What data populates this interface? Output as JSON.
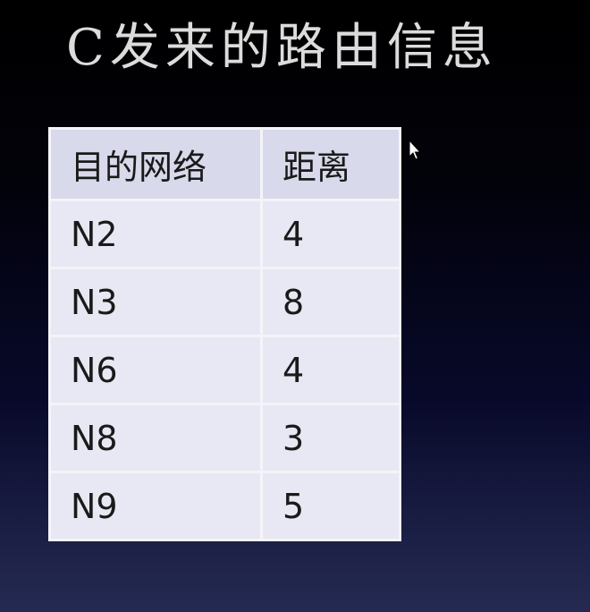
{
  "title": "C发来的路由信息",
  "table": {
    "headers": [
      "目的网络",
      "距离"
    ],
    "rows": [
      {
        "network": "N2",
        "distance": "4"
      },
      {
        "network": "N3",
        "distance": "8"
      },
      {
        "network": "N6",
        "distance": "4"
      },
      {
        "network": "N8",
        "distance": "3"
      },
      {
        "network": "N9",
        "distance": "5"
      }
    ]
  },
  "colors": {
    "background_top": "#000000",
    "background_bottom": "#252a52",
    "title_text": "#dcdcdc",
    "header_cell": "#d8d9ea",
    "body_cell": "#e8e8f4",
    "cell_text": "#1a1a1a"
  },
  "icons": {
    "cursor": "mouse-pointer-icon"
  }
}
